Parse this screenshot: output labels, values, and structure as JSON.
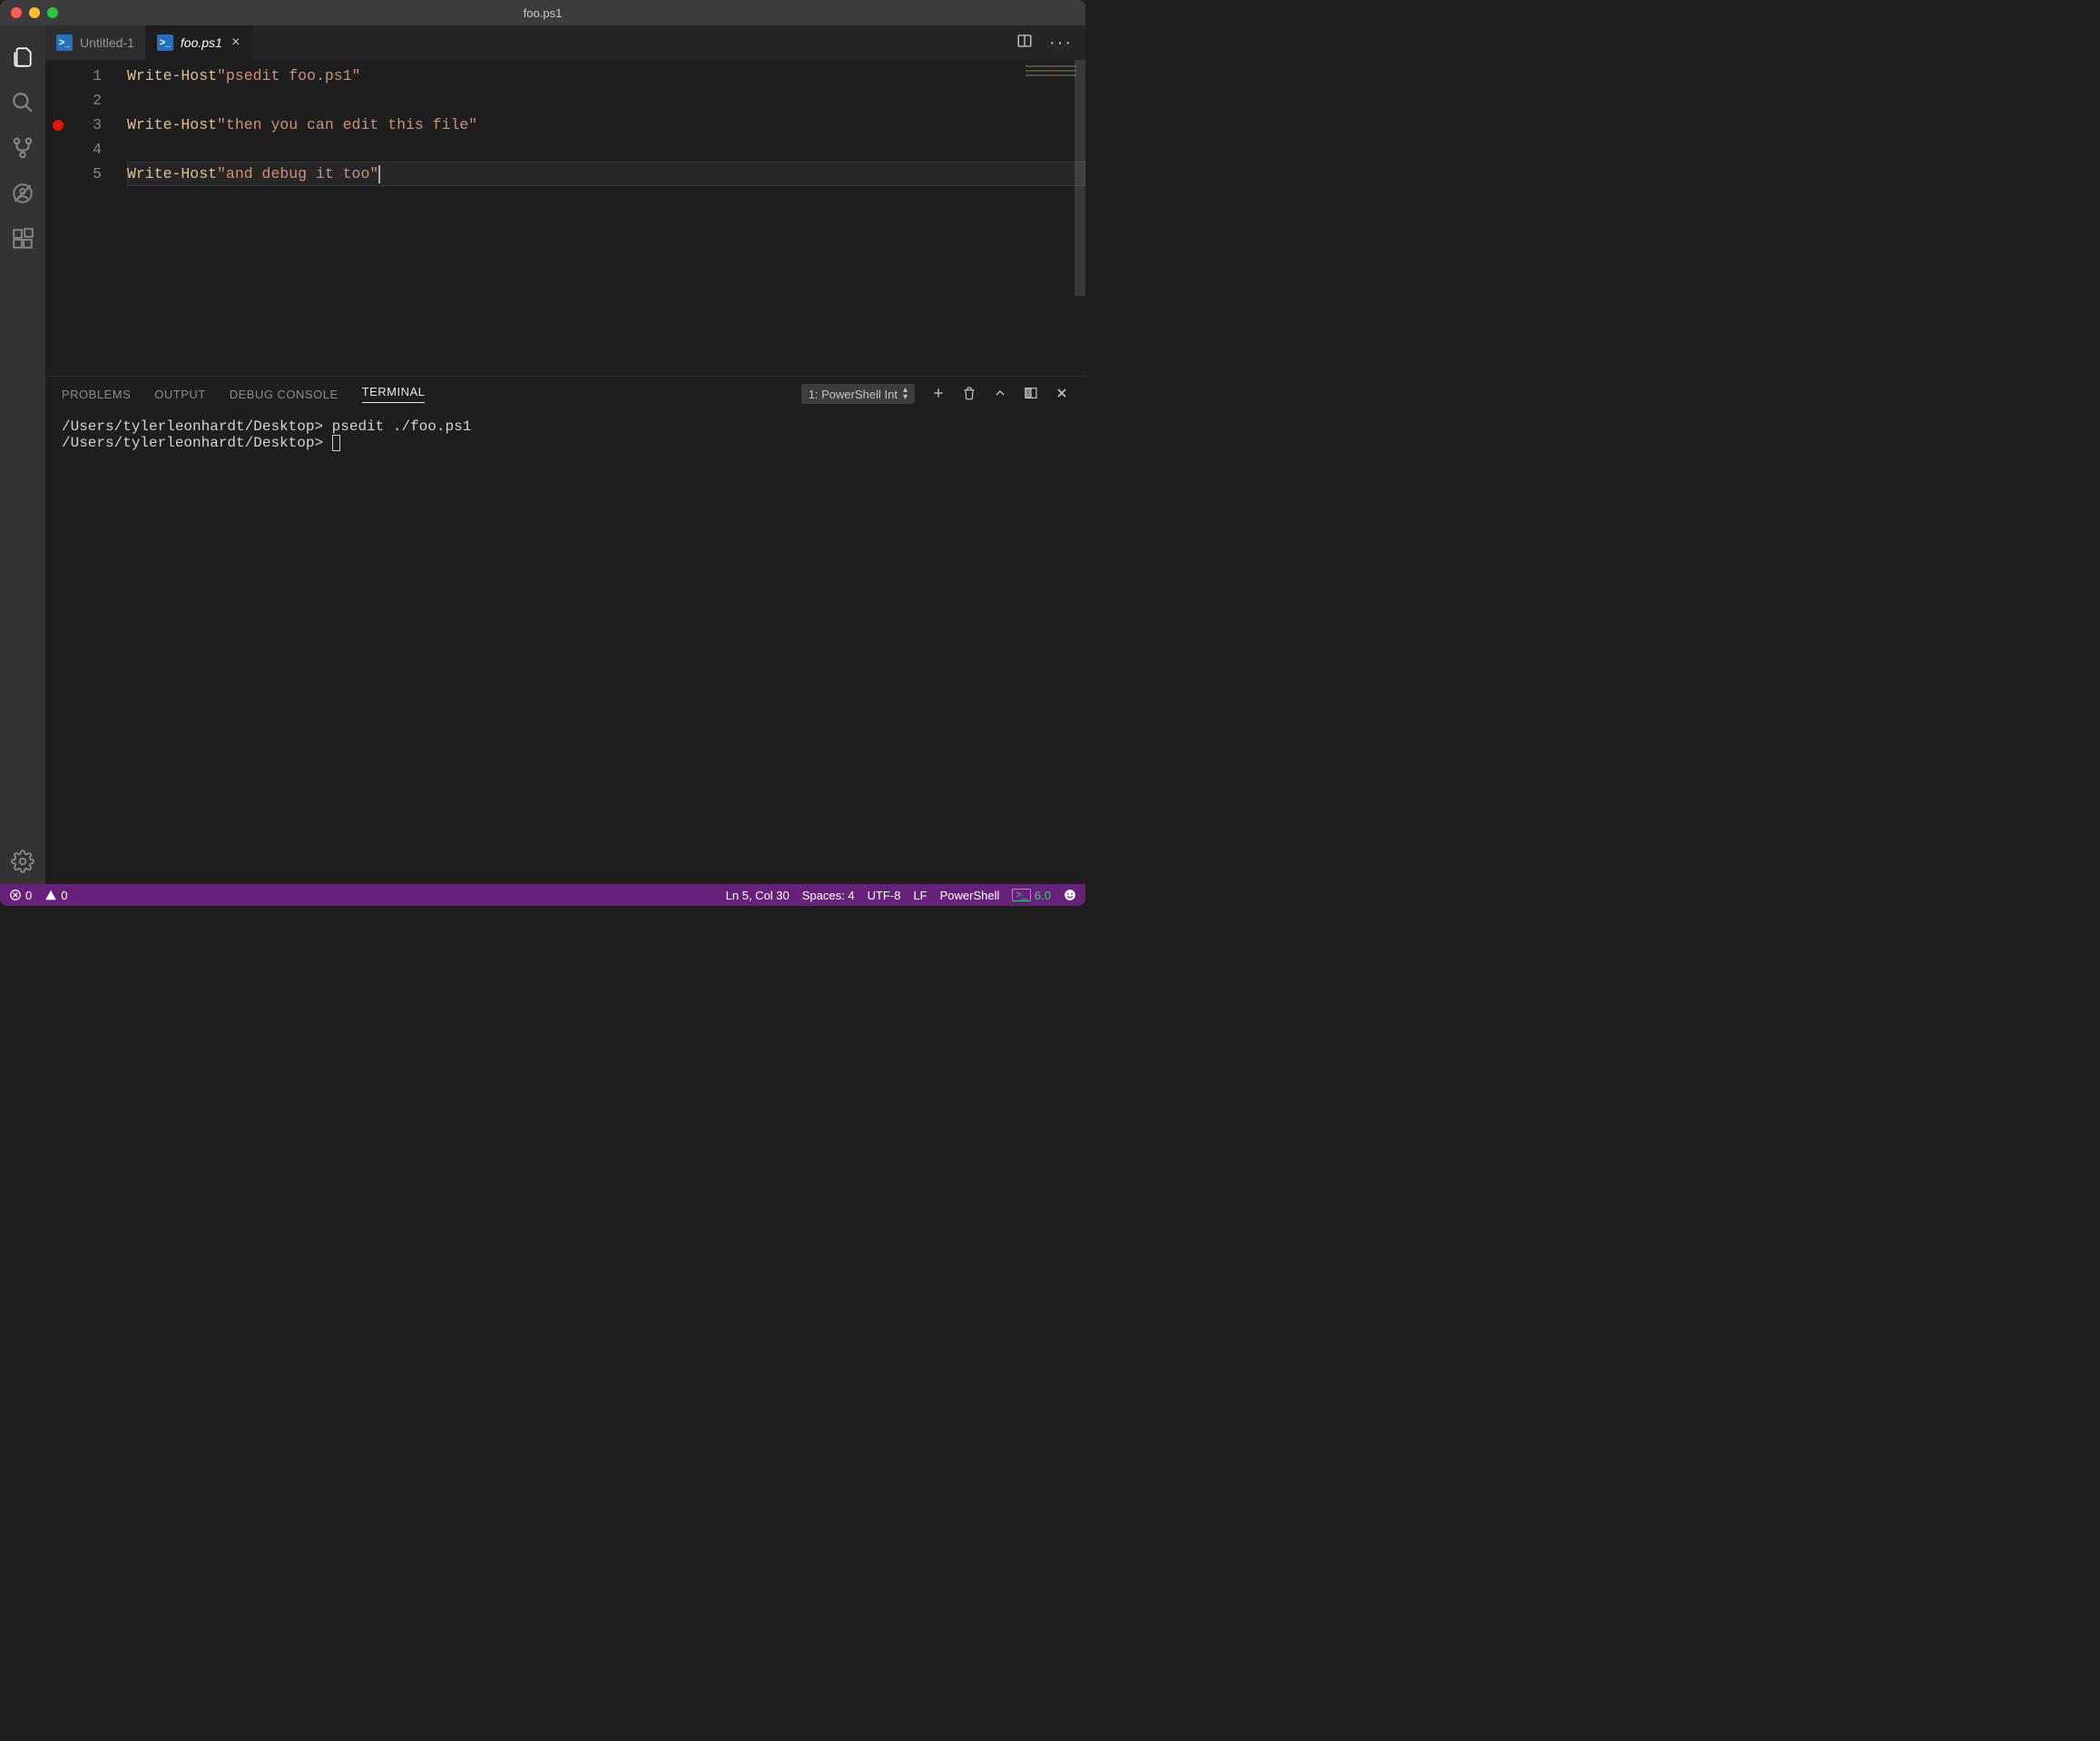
{
  "window": {
    "title": "foo.ps1"
  },
  "activitybar": {
    "items": [
      {
        "name": "explorer-icon"
      },
      {
        "name": "search-icon"
      },
      {
        "name": "source-control-icon"
      },
      {
        "name": "debug-icon"
      },
      {
        "name": "extensions-icon"
      }
    ],
    "settings": {
      "name": "gear-icon"
    }
  },
  "tabs": {
    "items": [
      {
        "label": "Untitled-1",
        "icon": ">_",
        "active": false,
        "dirty": false
      },
      {
        "label": "foo.ps1",
        "icon": ">_",
        "active": true,
        "dirty": false
      }
    ]
  },
  "editor": {
    "lines": [
      {
        "num": "1",
        "cmd": "Write-Host",
        "str": "\"psedit foo.ps1\"",
        "bp": false,
        "current": false
      },
      {
        "num": "2",
        "cmd": "",
        "str": "",
        "bp": false,
        "current": false
      },
      {
        "num": "3",
        "cmd": "Write-Host",
        "str": "\"then you can edit this file\"",
        "bp": true,
        "current": false
      },
      {
        "num": "4",
        "cmd": "",
        "str": "",
        "bp": false,
        "current": false
      },
      {
        "num": "5",
        "cmd": "Write-Host",
        "str": "\"and debug it too\"",
        "bp": false,
        "current": true
      }
    ]
  },
  "panel": {
    "tabs": {
      "problems": "PROBLEMS",
      "output": "OUTPUT",
      "debugConsole": "DEBUG CONSOLE",
      "terminal": "TERMINAL"
    },
    "terminalSelector": "1: PowerShell Int",
    "terminal": {
      "line1_prompt": "/Users/tylerleonhardt/Desktop>",
      "line1_cmd": " psedit ./foo.ps1",
      "line2_prompt": "/Users/tylerleonhardt/Desktop> "
    }
  },
  "status": {
    "errors": "0",
    "warnings": "0",
    "cursor": "Ln 5, Col 30",
    "indent": "Spaces: 4",
    "encoding": "UTF-8",
    "eol": "LF",
    "language": "PowerShell",
    "psVersion": "6.0"
  },
  "icons": {
    "ps": ">_"
  }
}
